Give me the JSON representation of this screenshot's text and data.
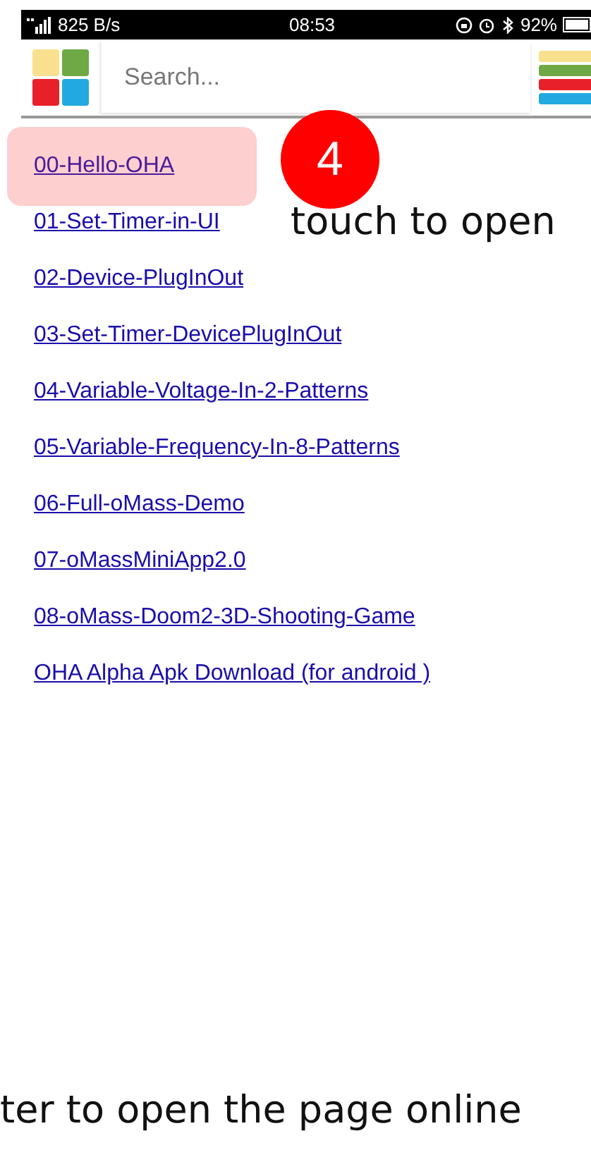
{
  "status_bar": {
    "network_speed": "825 B/s",
    "time": "08:53",
    "battery": "92%"
  },
  "search": {
    "placeholder": "Search..."
  },
  "links": [
    {
      "label": "00-Hello-OHA",
      "selected": true
    },
    {
      "label": "01-Set-Timer-in-UI",
      "selected": false
    },
    {
      "label": "02-Device-PlugInOut",
      "selected": false
    },
    {
      "label": "03-Set-Timer-DevicePlugInOut",
      "selected": false
    },
    {
      "label": "04-Variable-Voltage-In-2-Patterns",
      "selected": false
    },
    {
      "label": "05-Variable-Frequency-In-8-Patterns",
      "selected": false
    },
    {
      "label": "06-Full-oMass-Demo",
      "selected": false
    },
    {
      "label": "07-oMassMiniApp2.0",
      "selected": false
    },
    {
      "label": "08-oMass-Doom2-3D-Shooting-Game",
      "selected": false
    },
    {
      "label": "OHA Alpha Apk Download (for android )",
      "selected": false
    }
  ],
  "annotations": {
    "step_badge": "4",
    "callout": "touch to open",
    "footer_caption": "ter to open the page online"
  }
}
